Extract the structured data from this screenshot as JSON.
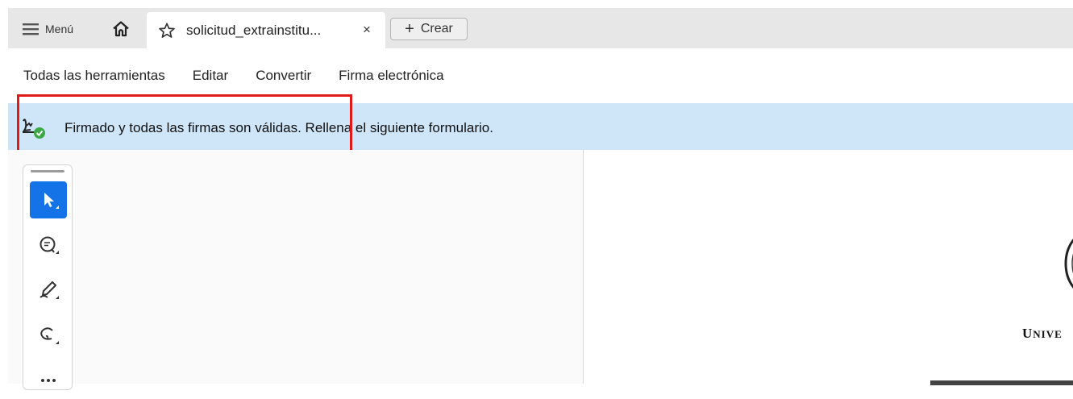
{
  "tabbar": {
    "menu_label": "Menú",
    "tab_title": "solicitud_extrainstitu...",
    "tab_close": "×",
    "create_label": "Crear"
  },
  "toolbar": {
    "items": [
      {
        "label": "Todas las herramientas"
      },
      {
        "label": "Editar"
      },
      {
        "label": "Convertir"
      },
      {
        "label": "Firma electrónica"
      }
    ]
  },
  "notification": {
    "message": "Firmado y todas las firmas son válidas. Rellena el siguiente formulario.",
    "icon": "signature-valid-icon",
    "status_color": "#3aa845"
  },
  "tools": [
    {
      "name": "select-tool",
      "icon": "arrow-cursor-icon",
      "active": true
    },
    {
      "name": "comment-tool",
      "icon": "comment-icon",
      "active": false
    },
    {
      "name": "draw-tool",
      "icon": "pen-icon",
      "active": false
    },
    {
      "name": "lasso-tool",
      "icon": "lasso-icon",
      "active": false
    },
    {
      "name": "more-tool",
      "icon": "more-icon",
      "active": false
    }
  ],
  "document": {
    "university_first": "U",
    "university_rest": "NIVE"
  },
  "colors": {
    "accent": "#1473e6",
    "notification_bg": "#cfe5f8",
    "highlight": "#e11919"
  }
}
